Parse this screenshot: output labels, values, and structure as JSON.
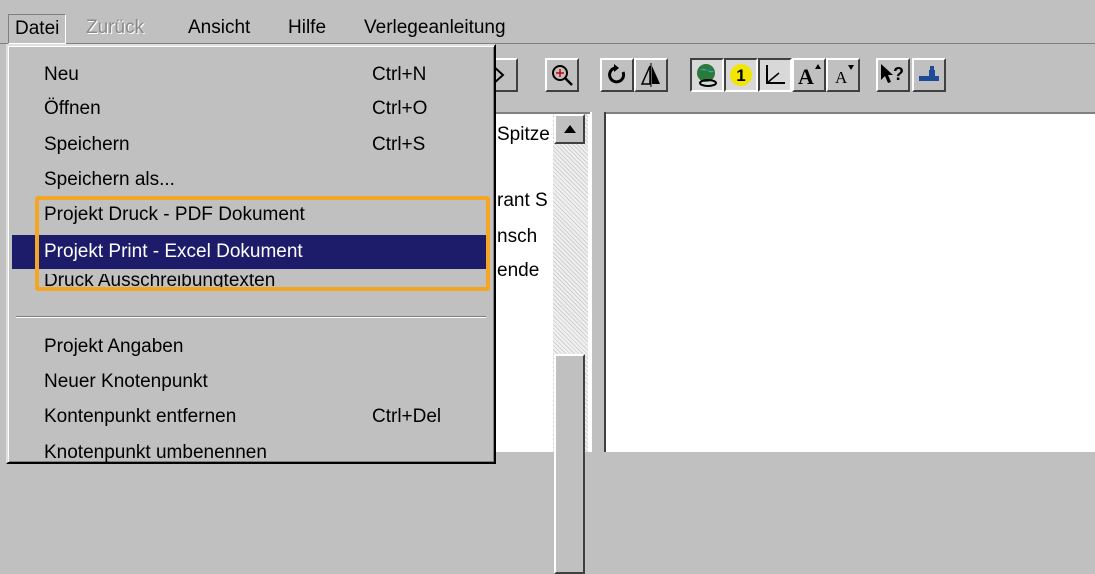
{
  "menubar": {
    "items": [
      {
        "label": "Datei",
        "state": "open"
      },
      {
        "label": "Zurück",
        "state": "disabled"
      },
      {
        "label": "Ansicht",
        "state": "normal"
      },
      {
        "label": "Hilfe",
        "state": "normal"
      },
      {
        "label": "Verlegeanleitung",
        "state": "normal"
      }
    ]
  },
  "file_menu": {
    "items": [
      {
        "label": "Neu",
        "shortcut": "Ctrl+N"
      },
      {
        "label": "Öffnen",
        "shortcut": "Ctrl+O"
      },
      {
        "label": "Speichern",
        "shortcut": "Ctrl+S"
      },
      {
        "label": "Speichern als...",
        "shortcut": ""
      },
      {
        "label": "Projekt Druck - PDF Dokument",
        "shortcut": ""
      },
      {
        "label": "Projekt Print - Excel Dokument",
        "shortcut": "",
        "selected": true
      },
      {
        "label": "Druck Ausschreibungtexten",
        "shortcut": ""
      },
      {
        "label": "Projekt Angaben",
        "shortcut": ""
      },
      {
        "label": "Neuer Knotenpunkt",
        "shortcut": ""
      },
      {
        "label": "Kontenpunkt entfernen",
        "shortcut": "Ctrl+Del"
      },
      {
        "label": "Knotenpunkt umbenennen",
        "shortcut": ""
      }
    ]
  },
  "toolbar": {
    "buttons": [
      {
        "icon": "partial-button-icon"
      },
      {
        "icon": "zoom-icon"
      },
      {
        "icon": "rotate-icon"
      },
      {
        "icon": "mirror-icon"
      },
      {
        "icon": "globe-link-icon",
        "pressed": true
      },
      {
        "icon": "yellow-number-icon",
        "text": "1",
        "pressed": true
      },
      {
        "icon": "axes-icon",
        "pressed": true
      },
      {
        "icon": "font-larger-icon",
        "text": "A"
      },
      {
        "icon": "font-smaller-icon",
        "text": "A"
      },
      {
        "icon": "help-pointer-icon",
        "text": "?"
      },
      {
        "icon": "tool-icon"
      }
    ],
    "badge_color": "#f2e600"
  },
  "tree_list": {
    "visible_fragments": [
      "Spitze",
      "rant S",
      "nsch",
      "ende"
    ]
  },
  "colors": {
    "selection": "#1c1c6b",
    "highlight_frame": "#f5a524",
    "chrome": "#c0c0c0"
  }
}
